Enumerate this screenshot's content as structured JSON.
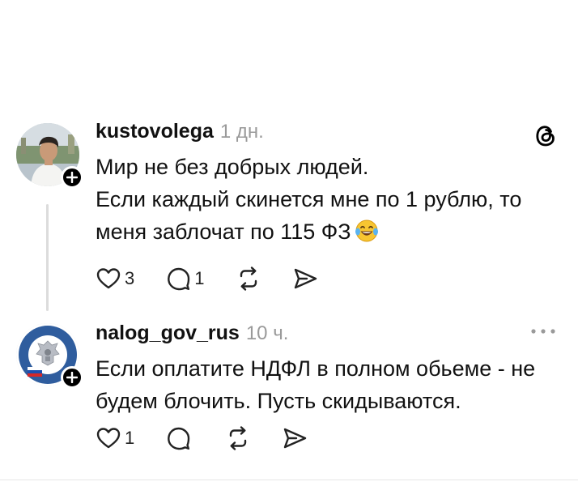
{
  "posts": [
    {
      "username": "kustovolega",
      "timestamp": "1 дн.",
      "lines": [
        "Мир не без добрых людей.",
        "Если каждый скинется мне по 1 рублю, то",
        "меня заблочат по 115 ФЗ"
      ],
      "emoji": "tears-of-joy-emoji",
      "likes": "3",
      "replies": "1",
      "corner_icon": "threads-logo-icon"
    },
    {
      "username": "nalog_gov_rus",
      "timestamp": "10 ч.",
      "lines": [
        "Если оплатите НДФЛ в полном обьеме - не",
        "будем блочить. Пусть скидываются."
      ],
      "likes": "1",
      "replies": "",
      "corner_icon": "more-options-icon"
    }
  ],
  "colors": {
    "text": "#111111",
    "muted": "#9a9a9a",
    "thread_line": "#dcdcdc",
    "badge": "#000000"
  }
}
